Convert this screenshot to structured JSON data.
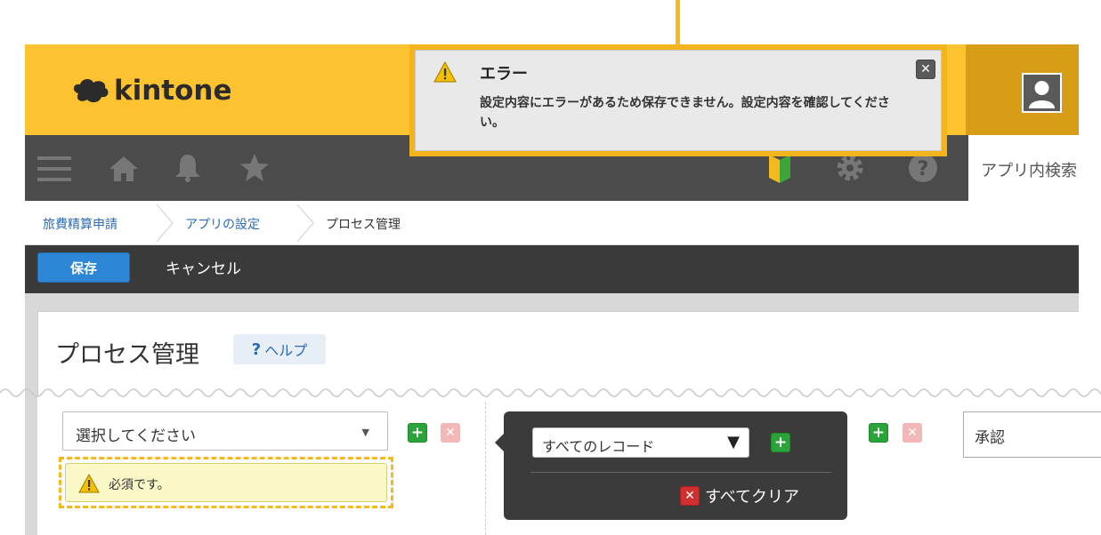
{
  "app": {
    "logo_text": "kintone"
  },
  "nav": {
    "search_placeholder": "アプリ内検索"
  },
  "breadcrumb": {
    "items": [
      "旅費精算申請",
      "アプリの設定",
      "プロセス管理"
    ]
  },
  "toolbar": {
    "save_label": "保存",
    "cancel_label": "キャンセル"
  },
  "page": {
    "title": "プロセス管理",
    "help_label": "ヘルプ",
    "help_icon": "?"
  },
  "assignee": {
    "select_value": "選択してください",
    "required_message": "必須です。"
  },
  "condition": {
    "select_value": "すべてのレコード",
    "clear_all_label": "すべてクリア"
  },
  "action": {
    "name_value": "承認"
  },
  "error": {
    "title": "エラー",
    "message": "設定内容にエラーがあるため保存できません。設定内容を確認してください。"
  },
  "colors": {
    "header_yellow": "#fdc230",
    "accent_orange": "#f5b81f",
    "nav_dark": "#4b4b4b",
    "link_blue": "#2b6bb5",
    "save_blue": "#2d86d6",
    "add_green": "#2aa43a",
    "remove_red": "#d12e2e"
  },
  "icons": [
    "kintone-logo-icon",
    "menu-icon",
    "home-icon",
    "bell-icon",
    "star-icon",
    "beginner-icon",
    "gear-icon",
    "help-icon",
    "user-avatar-icon",
    "warning-icon",
    "close-icon",
    "add-icon",
    "remove-icon"
  ]
}
